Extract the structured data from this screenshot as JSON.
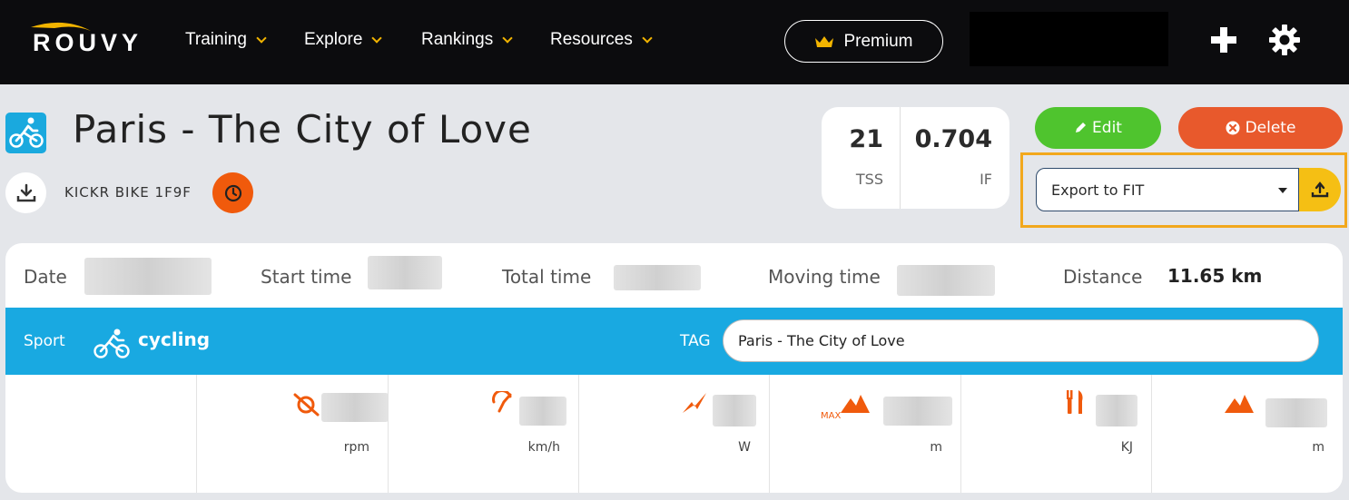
{
  "nav": {
    "logo": "ROUVY",
    "items": [
      {
        "label": "Training"
      },
      {
        "label": "Explore"
      },
      {
        "label": "Rankings"
      },
      {
        "label": "Resources"
      }
    ],
    "premium_label": "Premium",
    "accent": "#f2b400"
  },
  "activity": {
    "title": "Paris - The City of Love",
    "device": "KICKR BIKE 1F9F",
    "sport_icon": "cycling-icon"
  },
  "stats": {
    "tss_value": "21",
    "tss_label": "TSS",
    "if_value": "0.704",
    "if_label": "IF"
  },
  "actions": {
    "edit_label": "Edit",
    "delete_label": "Delete",
    "export_selected": "Export to FIT",
    "edit_color": "#4fc42e",
    "delete_color": "#e8592c",
    "export_color": "#f5bf14"
  },
  "details": {
    "date_label": "Date",
    "start_label": "Start time",
    "total_label": "Total time",
    "moving_label": "Moving time",
    "distance_label": "Distance",
    "distance_value": "11.65 km"
  },
  "sport_bar": {
    "sport_label": "Sport",
    "sport_value": "cycling",
    "tag_label": "TAG",
    "tag_value": "Paris - The City of Love",
    "color": "#19a9e1"
  },
  "metrics": [
    {
      "icon": "cadence-icon",
      "unit": "rpm"
    },
    {
      "icon": "speed-icon",
      "unit": "km/h"
    },
    {
      "icon": "power-icon",
      "unit": "W"
    },
    {
      "icon": "max-elevation-icon",
      "badge": "MAX",
      "unit": "m"
    },
    {
      "icon": "energy-icon",
      "unit": "KJ"
    },
    {
      "icon": "elevation-icon",
      "unit": "m"
    }
  ]
}
